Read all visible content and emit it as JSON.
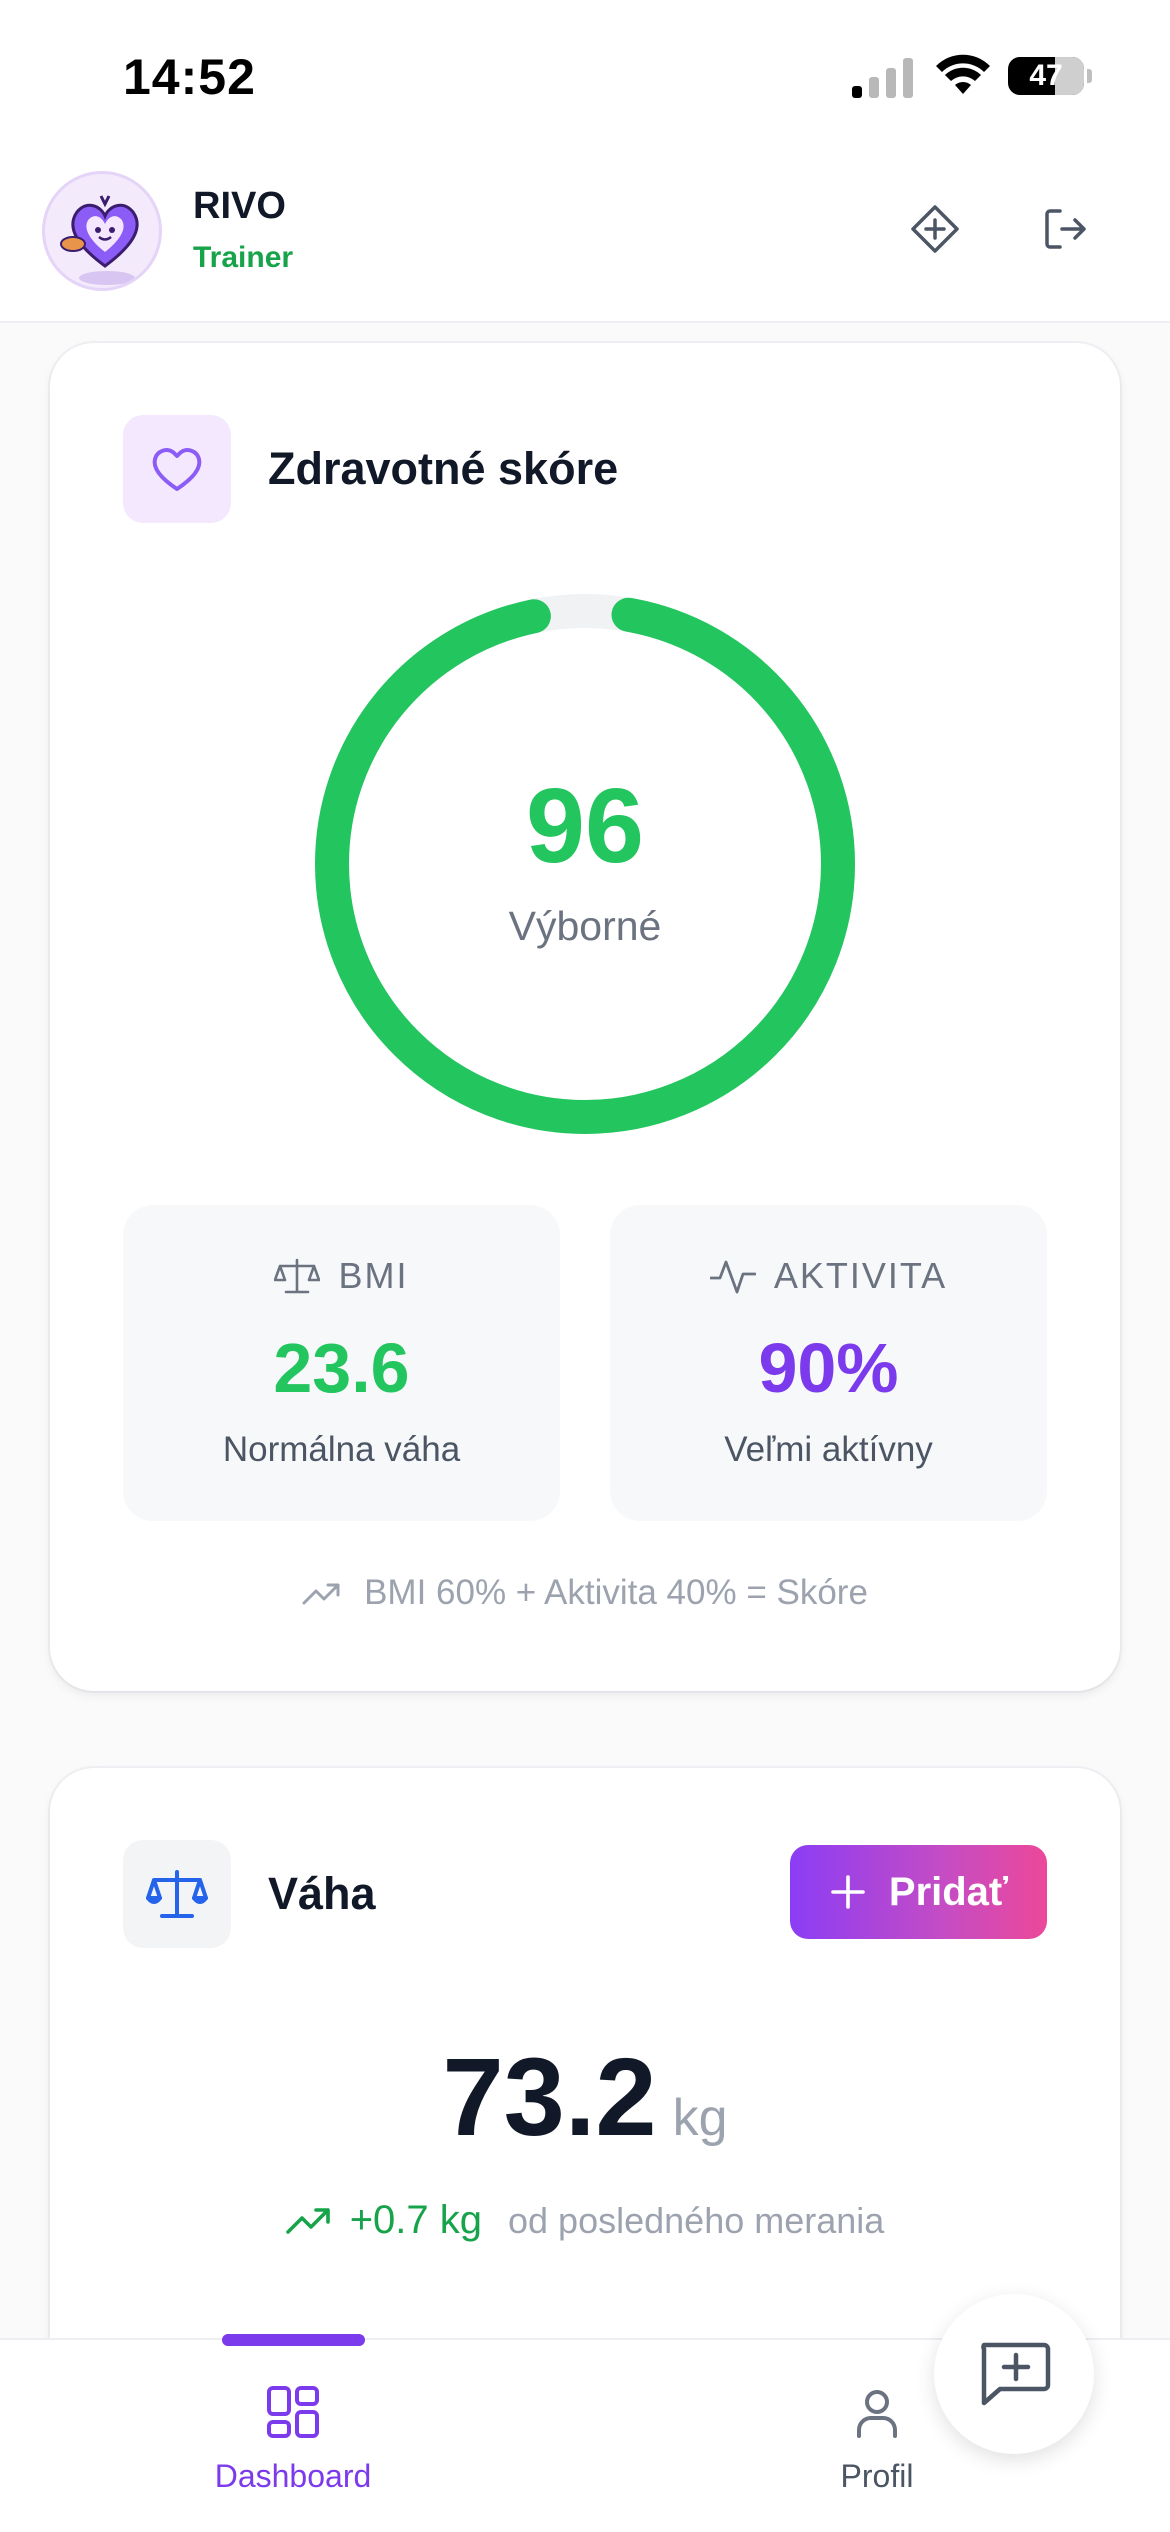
{
  "status_bar": {
    "time": "14:52",
    "battery": "47"
  },
  "header": {
    "user_name": "RIVO",
    "user_role": "Trainer",
    "actions": [
      "diamond-plus-icon",
      "logout-icon"
    ]
  },
  "score_card": {
    "title": "Zdravotné skóre",
    "score": "96",
    "score_fraction": 0.96,
    "score_label": "Výborné",
    "bmi": {
      "label": "BMI",
      "value": "23.6",
      "note": "Normálna váha"
    },
    "activity": {
      "label": "AKTIVITA",
      "value": "90%",
      "note": "Veľmi aktívny"
    },
    "formula": "BMI 60% + Aktivita 40% = Skóre"
  },
  "weight_card": {
    "title": "Váha",
    "add_label": "Pridať",
    "value": "73.2",
    "unit": "kg",
    "change": "+0.7 kg",
    "change_note": "od posledného merania"
  },
  "nav": {
    "dashboard": "Dashboard",
    "profile": "Profil"
  },
  "colors": {
    "green": "#22c55e",
    "purple": "#7c3aed",
    "activity_purple": "#7c3aed",
    "brand_gradient_start": "#8b3df5",
    "brand_gradient_end": "#ec4899"
  }
}
